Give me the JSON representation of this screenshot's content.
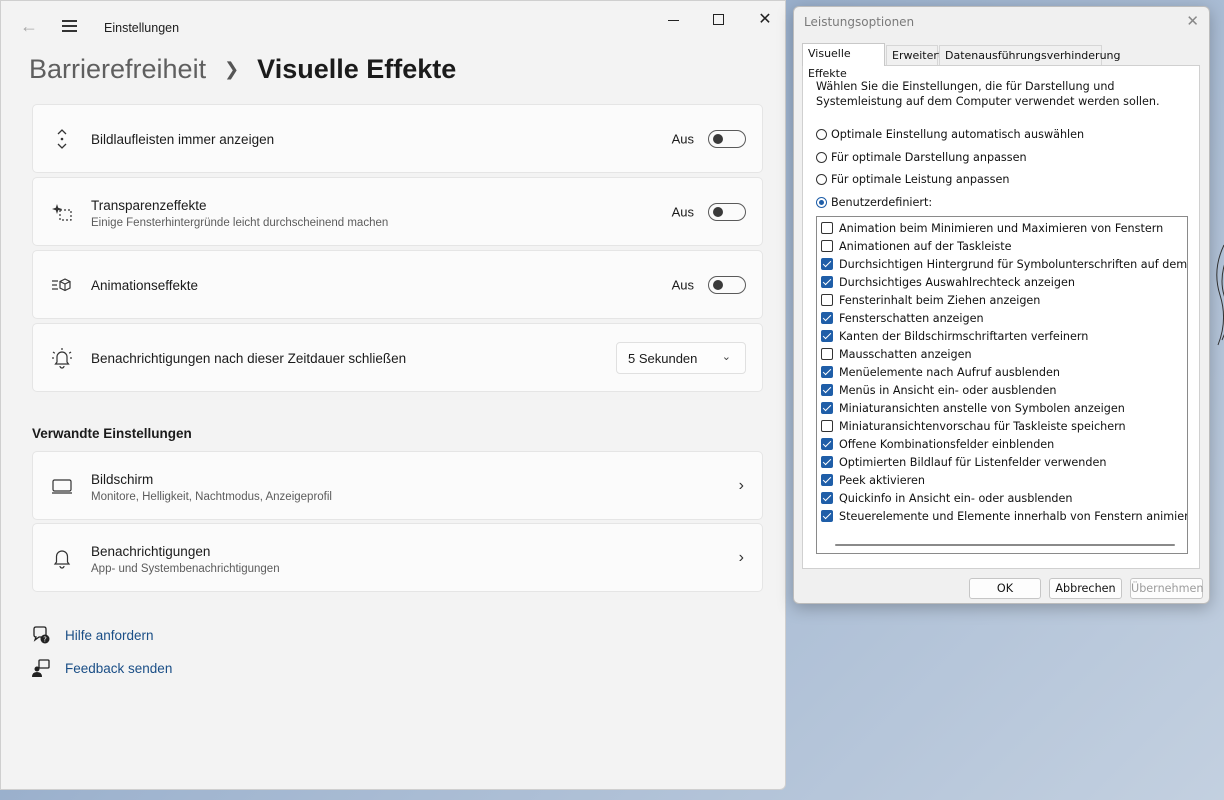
{
  "settings": {
    "window_title": "Einstellungen",
    "breadcrumb": {
      "parent": "Barrierefreiheit",
      "current": "Visuelle Effekte"
    },
    "cards": [
      {
        "label": "Bildlaufleisten immer anzeigen",
        "state": "Aus",
        "icon": "scrollbar-icon"
      },
      {
        "label": "Transparenzeffekte",
        "sub": "Einige Fensterhintergründe leicht durchscheinend machen",
        "state": "Aus",
        "icon": "transparency-icon"
      },
      {
        "label": "Animationseffekte",
        "state": "Aus",
        "icon": "animation-icon"
      },
      {
        "label": "Benachrichtigungen nach dieser Zeitdauer schließen",
        "select_value": "5 Sekunden",
        "icon": "notification-timer-icon"
      }
    ],
    "related_title": "Verwandte Einstellungen",
    "related": [
      {
        "label": "Bildschirm",
        "sub": "Monitore, Helligkeit, Nachtmodus, Anzeigeprofil",
        "icon": "monitor-icon"
      },
      {
        "label": "Benachrichtigungen",
        "sub": "App- und Systembenachrichtigungen",
        "icon": "bell-icon"
      }
    ],
    "links": [
      {
        "label": "Hilfe anfordern",
        "icon": "help-icon"
      },
      {
        "label": "Feedback senden",
        "icon": "feedback-icon"
      }
    ]
  },
  "perf": {
    "title": "Leistungsoptionen",
    "tabs": [
      "Visuelle Effekte",
      "Erweitert",
      "Datenausführungsverhinderung"
    ],
    "description": "Wählen Sie die Einstellungen, die für Darstellung und Systemleistung auf dem Computer verwendet werden sollen.",
    "radios": [
      {
        "label": "Optimale Einstellung automatisch auswählen",
        "checked": false
      },
      {
        "label": "Für optimale Darstellung anpassen",
        "checked": false
      },
      {
        "label": "Für optimale Leistung anpassen",
        "checked": false
      },
      {
        "label": "Benutzerdefiniert:",
        "checked": true
      }
    ],
    "options": [
      {
        "label": "Animation beim Minimieren und Maximieren von Fenstern",
        "checked": false
      },
      {
        "label": "Animationen auf der Taskleiste",
        "checked": false
      },
      {
        "label": "Durchsichtigen Hintergrund für Symbolunterschriften auf dem De",
        "checked": true
      },
      {
        "label": "Durchsichtiges Auswahlrechteck anzeigen",
        "checked": true
      },
      {
        "label": "Fensterinhalt beim Ziehen anzeigen",
        "checked": false
      },
      {
        "label": "Fensterschatten anzeigen",
        "checked": true
      },
      {
        "label": "Kanten der Bildschirmschriftarten verfeinern",
        "checked": true
      },
      {
        "label": "Mausschatten anzeigen",
        "checked": false
      },
      {
        "label": "Menüelemente nach Aufruf ausblenden",
        "checked": true
      },
      {
        "label": "Menüs in Ansicht ein- oder ausblenden",
        "checked": true
      },
      {
        "label": "Miniaturansichten anstelle von Symbolen anzeigen",
        "checked": true
      },
      {
        "label": "Miniaturansichtenvorschau für Taskleiste speichern",
        "checked": false
      },
      {
        "label": "Offene Kombinationsfelder einblenden",
        "checked": true
      },
      {
        "label": "Optimierten Bildlauf für Listenfelder verwenden",
        "checked": true
      },
      {
        "label": "Peek aktivieren",
        "checked": true
      },
      {
        "label": "Quickinfo in Ansicht ein- oder ausblenden",
        "checked": true
      },
      {
        "label": "Steuerelemente und Elemente innerhalb von Fenstern animieren",
        "checked": true
      }
    ],
    "buttons": {
      "ok": "OK",
      "cancel": "Abbrechen",
      "apply": "Übernehmen"
    },
    "accent": "#1f5ea8"
  }
}
